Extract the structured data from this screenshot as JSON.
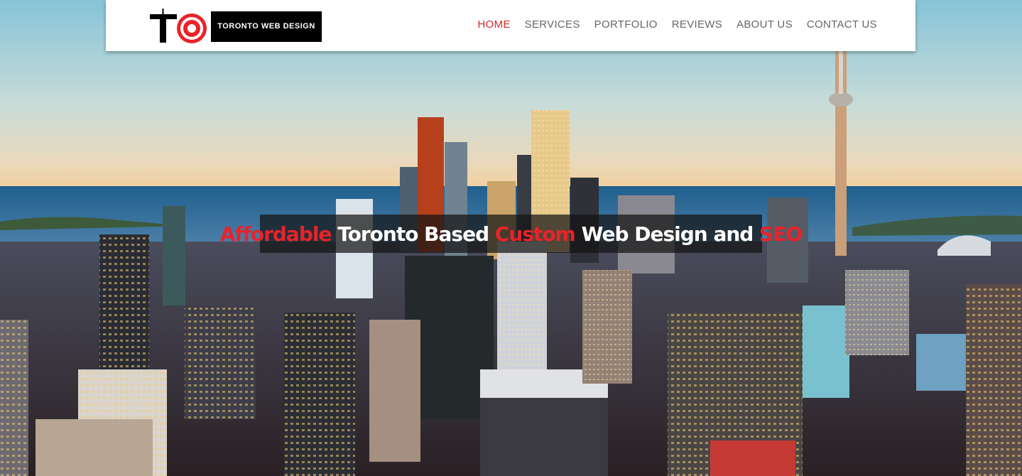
{
  "brand": {
    "logo_text": "TORONTO WEB DESIGN",
    "accent_color": "#e8232a",
    "logo_icon": "to-monogram-icon"
  },
  "nav": {
    "items": [
      {
        "label": "HOME",
        "active": true
      },
      {
        "label": "SERVICES",
        "active": false
      },
      {
        "label": "PORTFOLIO",
        "active": false
      },
      {
        "label": "REVIEWS",
        "active": false
      },
      {
        "label": "ABOUT US",
        "active": false
      },
      {
        "label": "CONTACT US",
        "active": false
      }
    ],
    "active_color": "#d62828",
    "color": "#666666"
  },
  "hero": {
    "parts": [
      {
        "text": "Affordable",
        "highlight": true
      },
      {
        "text": " Toronto Based ",
        "highlight": false
      },
      {
        "text": "Custom",
        "highlight": true
      },
      {
        "text": " Web Design and ",
        "highlight": false
      },
      {
        "text": "SEO",
        "highlight": true
      }
    ]
  }
}
